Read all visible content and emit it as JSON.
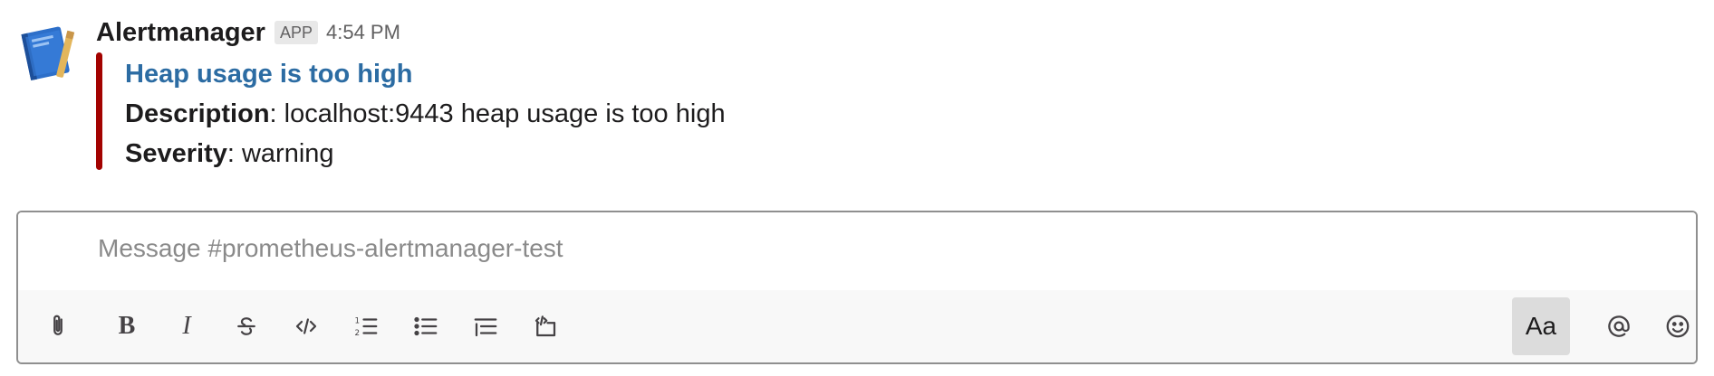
{
  "message": {
    "sender": "Alertmanager",
    "badge": "APP",
    "time": "4:54 PM",
    "attachment": {
      "color": "#a30200",
      "title": "Heap usage is too high",
      "fields": [
        {
          "label": "Description",
          "value": ": localhost:9443 heap usage is too high"
        },
        {
          "label": "Severity",
          "value": ": warning"
        }
      ]
    }
  },
  "composer": {
    "placeholder": "Message #prometheus-alertmanager-test",
    "toolbar": {
      "bold_label": "B",
      "italic_label": "I",
      "format_label": "Aa"
    },
    "icons": [
      "paperclip-icon",
      "bold-icon",
      "italic-icon",
      "strikethrough-icon",
      "code-icon",
      "numbered-list-icon",
      "bulleted-list-icon",
      "blockquote-icon",
      "code-block-icon",
      "format-toggle-icon",
      "mention-icon",
      "emoji-icon"
    ]
  }
}
